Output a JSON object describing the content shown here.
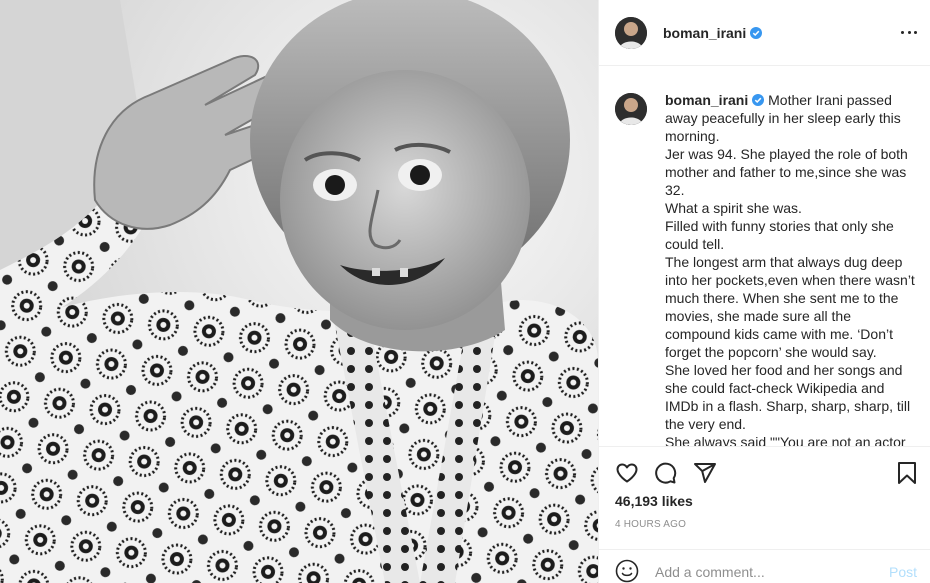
{
  "post": {
    "username": "boman_irani",
    "verified": true,
    "caption_lines": [
      "Mother Irani passed away peacefully in her sleep early this morning.",
      "Jer was 94. She played the role of both mother and father to me,since she was 32.",
      "What a spirit she was.",
      "Filled with funny stories that only she could tell.",
      "The longest arm that always dug deep into her pockets,even when there wasn’t much there. When she sent me to the movies, she made sure all the compound kids came with me. ‘Don’t forget the popcorn’ she would say.",
      "She loved her food and her songs and she could fact-check Wikipedia and IMDb in a flash. Sharp, sharp, sharp, till the very end.",
      "She always said \"\"You are not an actor"
    ],
    "likes": "46,193 likes",
    "timestamp": "4 HOURS AGO"
  },
  "comment_box": {
    "placeholder": "Add a comment...",
    "post_label": "Post"
  },
  "icons": {
    "like": "heart-icon",
    "comment": "comment-bubble-icon",
    "share": "paper-plane-icon",
    "save": "bookmark-icon",
    "emoji": "smiley-icon",
    "more": "more-dots-icon",
    "verified": "verified-badge-icon"
  },
  "colors": {
    "verified_badge": "#3897f0",
    "post_button_disabled": "#b2dffc",
    "secondary_text": "#8e8e8e",
    "divider": "#efefef"
  }
}
